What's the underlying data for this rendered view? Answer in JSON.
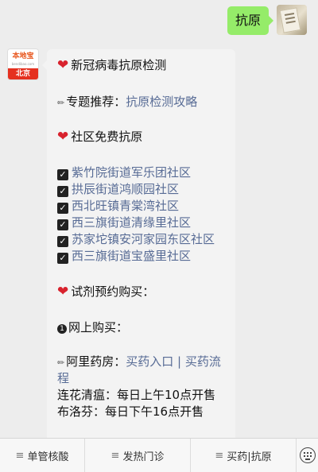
{
  "outgoing": {
    "text": "抗原"
  },
  "brand": {
    "name": "本地宝",
    "url": "bendibao.com",
    "city": "北京"
  },
  "incoming": {
    "heading1": "新冠病毒抗原检测",
    "topic_label": "专题推荐：",
    "topic_link": "抗原检测攻略",
    "heading2": "社区免费抗原",
    "communities": [
      "紫竹院街道军乐团社区",
      "拱辰街道鸿顺园社区",
      "西北旺镇青棠湾社区",
      "西三旗街道清缘里社区",
      "苏家坨镇安河家园东区社区",
      "西三旗街道宝盛里社区"
    ],
    "heading3": "试剂预约购买：",
    "online_label": "网上购买：",
    "pharmacy_label": "阿里药房：",
    "buy_link": "买药入口",
    "separator": "|",
    "flow_link_part1": "买药流",
    "flow_link_part2": "程",
    "schedule1": "连花清瘟：每日上午10点开售",
    "schedule2": "布洛芬：每日下午16点开售"
  },
  "menu": {
    "items": [
      "单管核酸",
      "发热门诊",
      "买药|抗原"
    ]
  },
  "icons": {
    "menu_item": "menu-lines-icon",
    "keyboard": "keyboard-icon",
    "heart": "heart-icon",
    "check": "checkbox-icon",
    "pencil": "pencil-icon",
    "number_one": "circled-one-icon"
  },
  "colors": {
    "outgoing_bubble": "#95ec69",
    "link": "#576b95",
    "heart": "#d8222d",
    "brand_red": "#e5301f"
  }
}
